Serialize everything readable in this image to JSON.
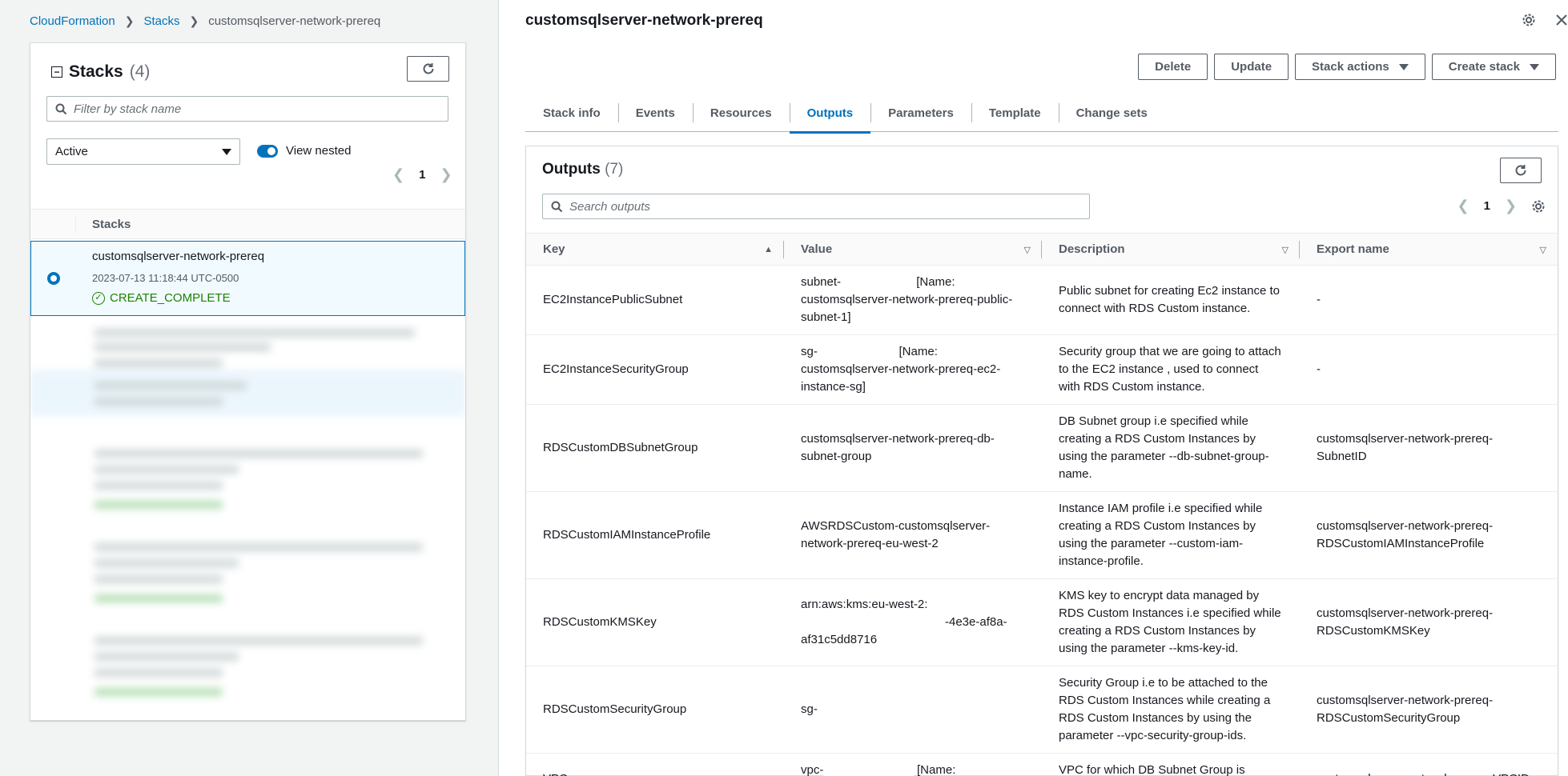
{
  "breadcrumb": {
    "root": "CloudFormation",
    "stacks": "Stacks",
    "current": "customsqlserver-network-prereq"
  },
  "stacks_panel": {
    "title": "Stacks",
    "count": "(4)",
    "filter_placeholder": "Filter by stack name",
    "status_filter": "Active",
    "view_nested": "View nested",
    "page": "1",
    "column_header": "Stacks",
    "selected_stack": {
      "name": "customsqlserver-network-prereq",
      "date": "2023-07-13 11:18:44 UTC-0500",
      "status": "CREATE_COMPLETE"
    }
  },
  "detail": {
    "title": "customsqlserver-network-prereq",
    "buttons": {
      "delete": "Delete",
      "update": "Update",
      "stack_actions": "Stack actions",
      "create_stack": "Create stack"
    },
    "tabs": [
      "Stack info",
      "Events",
      "Resources",
      "Outputs",
      "Parameters",
      "Template",
      "Change sets"
    ],
    "active_tab": "Outputs"
  },
  "outputs": {
    "title": "Outputs",
    "count": "(7)",
    "search_placeholder": "Search outputs",
    "page": "1",
    "columns": {
      "key": "Key",
      "value": "Value",
      "description": "Description",
      "export": "Export name"
    },
    "rows": [
      {
        "key": "EC2InstancePublicSubnet",
        "value_prefix": "subnet-",
        "value_suffix": " [Name: customsqlserver-network-prereq-public-subnet-1]",
        "description": "Public subnet for creating Ec2 instance to connect with RDS Custom instance.",
        "export": "-"
      },
      {
        "key": "EC2InstanceSecurityGroup",
        "value_prefix": "sg-",
        "value_suffix": " [Name: customsqlserver-network-prereq-ec2-instance-sg]",
        "description": "Security group that we are going to attach to the EC2 instance , used to connect with RDS Custom instance.",
        "export": "-"
      },
      {
        "key": "RDSCustomDBSubnetGroup",
        "value_prefix": "customsqlserver-network-prereq-db-subnet-group",
        "value_suffix": "",
        "description": "DB Subnet group i.e specified while creating a RDS Custom Instances by using the parameter --db-subnet-group-name.",
        "export": "customsqlserver-network-prereq-SubnetID"
      },
      {
        "key": "RDSCustomIAMInstanceProfile",
        "value_prefix": "AWSRDSCustom-customsqlserver-network-prereq-eu-west-2",
        "value_suffix": "",
        "description": "Instance IAM profile i.e specified while creating a RDS Custom Instances by using the parameter --custom-iam-instance-profile.",
        "export": "customsqlserver-network-prereq-RDSCustomIAMInstanceProfile"
      },
      {
        "key": "RDSCustomKMSKey",
        "value_prefix": "arn:aws:kms:eu-west-2:",
        "value_suffix": "-4e3e-af8a-af31c5dd8716",
        "description": "KMS key to encrypt data managed by RDS Custom Instances i.e specified while creating a RDS Custom Instances by using the parameter --kms-key-id.",
        "export": "customsqlserver-network-prereq-RDSCustomKMSKey"
      },
      {
        "key": "RDSCustomSecurityGroup",
        "value_prefix": "sg-",
        "value_suffix": "",
        "description": "Security Group i.e to be attached to the RDS Custom Instances while creating a RDS Custom Instances by using the parameter --vpc-security-group-ids.",
        "export": "customsqlserver-network-prereq-RDSCustomSecurityGroup"
      },
      {
        "key": "VPC",
        "value_prefix": "vpc-",
        "value_suffix": " [Name: customsqlserver-network-prereq-vpc]",
        "description": "VPC for which DB Subnet Group is created.",
        "export": "customsqlserver-network-prereq-VPCID"
      }
    ]
  },
  "colors": {
    "link": "#0073bb",
    "success": "#1d8102",
    "border": "#d5dbdb"
  }
}
